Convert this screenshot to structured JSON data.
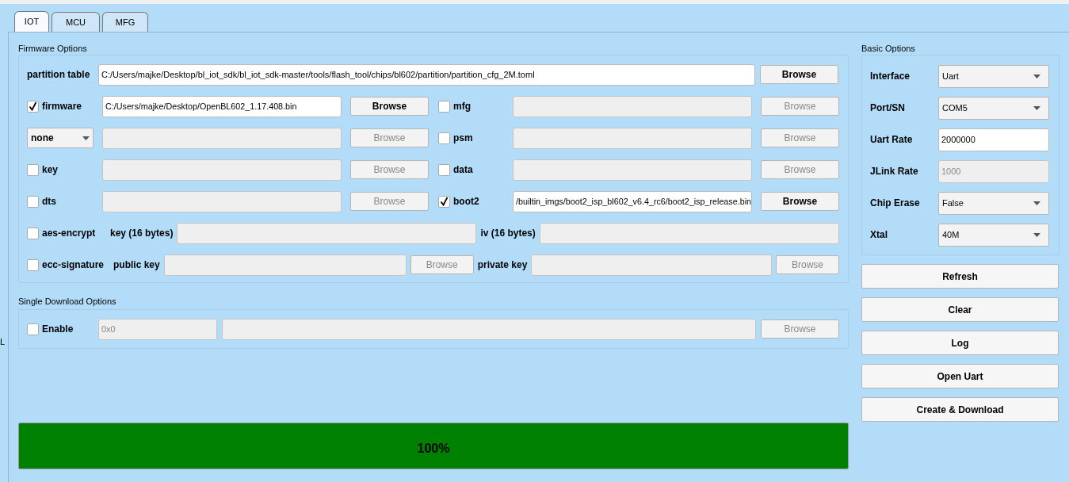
{
  "tabs": [
    {
      "label": "IOT",
      "selected": true
    },
    {
      "label": "MCU",
      "selected": false
    },
    {
      "label": "MFG",
      "selected": false
    }
  ],
  "left_edge_text": "L",
  "firmware_options": {
    "title": "Firmware Options",
    "partition_table": {
      "label": "partition table",
      "value": "C:/Users/majke/Desktop/bl_iot_sdk/bl_iot_sdk-master/tools/flash_tool/chips/bl602/partition/partition_cfg_2M.toml",
      "browse": "Browse"
    },
    "file_rows": [
      [
        {
          "kind": "checkbox",
          "label": "firmware",
          "checked": true,
          "enabled": true,
          "value": "C:/Users/majke/Desktop/OpenBL602_1.17.408.bin",
          "browse": "Browse"
        },
        {
          "kind": "checkbox",
          "label": "mfg",
          "checked": false,
          "enabled": false,
          "browse": "Browse"
        }
      ],
      [
        {
          "kind": "select",
          "label": "none",
          "enabled": false,
          "browse": "Browse"
        },
        {
          "kind": "checkbox",
          "label": "psm",
          "checked": false,
          "enabled": false,
          "browse": "Browse"
        }
      ],
      [
        {
          "kind": "checkbox",
          "label": "key",
          "checked": false,
          "enabled": false,
          "browse": "Browse"
        },
        {
          "kind": "checkbox",
          "label": "data",
          "checked": false,
          "enabled": false,
          "browse": "Browse"
        }
      ],
      [
        {
          "kind": "checkbox",
          "label": "dts",
          "checked": false,
          "enabled": false,
          "browse": "Browse"
        },
        {
          "kind": "checkbox",
          "label": "boot2",
          "checked": true,
          "enabled": true,
          "value": "/builtin_imgs/boot2_isp_bl602_v6.4_rc6/boot2_isp_release.bin",
          "browse": "Browse"
        }
      ]
    ],
    "aes": {
      "label": "aes-encrypt",
      "checked": false,
      "key_label": "key (16 bytes)",
      "iv_label": "iv (16 bytes)"
    },
    "ecc": {
      "label": "ecc-signature",
      "checked": false,
      "public_label": "public key",
      "public_browse": "Browse",
      "private_label": "private key",
      "private_browse": "Browse"
    }
  },
  "single_download": {
    "title": "Single Download Options",
    "label": "Enable",
    "checked": false,
    "address": "0x0",
    "browse": "Browse"
  },
  "basic_options": {
    "title": "Basic Options",
    "rows": [
      {
        "label": "Interface",
        "kind": "select",
        "value": "Uart",
        "enabled": true
      },
      {
        "label": "Port/SN",
        "kind": "select",
        "value": "COM5",
        "enabled": true
      },
      {
        "label": "Uart Rate",
        "kind": "input",
        "value": "2000000",
        "enabled": true
      },
      {
        "label": "JLink Rate",
        "kind": "input",
        "value": "1000",
        "enabled": false
      },
      {
        "label": "Chip Erase",
        "kind": "select",
        "value": "False",
        "enabled": true
      },
      {
        "label": "Xtal",
        "kind": "select",
        "value": "40M",
        "enabled": true
      }
    ]
  },
  "buttons": [
    "Refresh",
    "Clear",
    "Log",
    "Open Uart",
    "Create & Download"
  ],
  "progress": {
    "level": 1,
    "text": "100%"
  }
}
